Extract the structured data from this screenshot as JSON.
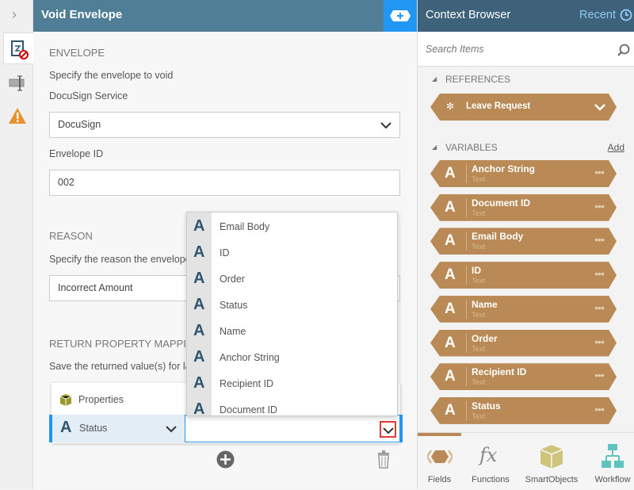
{
  "main": {
    "title": "Void Envelope",
    "envelope": {
      "heading": "ENVELOPE",
      "description": "Specify the envelope to void",
      "service_label": "DocuSign Service",
      "service_value": "DocuSign",
      "id_label": "Envelope ID",
      "id_value": "002"
    },
    "reason": {
      "heading": "REASON",
      "description": "Specify the reason the envelope",
      "value": "Incorrect Amount"
    },
    "mapping": {
      "heading": "RETURN PROPERTY MAPPING",
      "description": "Save the returned value(s) for la",
      "properties_label": "Properties",
      "row_property": "Status",
      "row_target": ""
    },
    "dropdown_items": [
      "Email Body",
      "ID",
      "Order",
      "Status",
      "Name",
      "Anchor String",
      "Recipient ID",
      "Document ID"
    ]
  },
  "context": {
    "title": "Context Browser",
    "recent": "Recent",
    "search_placeholder": "Search Items",
    "references_heading": "REFERENCES",
    "reference": "Leave Request",
    "variables_heading": "VARIABLES",
    "add": "Add",
    "variables": [
      {
        "name": "Anchor String",
        "type": "Text"
      },
      {
        "name": "Document ID",
        "type": "Text"
      },
      {
        "name": "Email Body",
        "type": "Text"
      },
      {
        "name": "ID",
        "type": "Text"
      },
      {
        "name": "Name",
        "type": "Text"
      },
      {
        "name": "Order",
        "type": "Text"
      },
      {
        "name": "Recipient ID",
        "type": "Text"
      },
      {
        "name": "Status",
        "type": "Text"
      }
    ],
    "tabs": [
      "Fields",
      "Functions",
      "SmartObjects",
      "Workflow"
    ]
  },
  "glyph_A": "A"
}
